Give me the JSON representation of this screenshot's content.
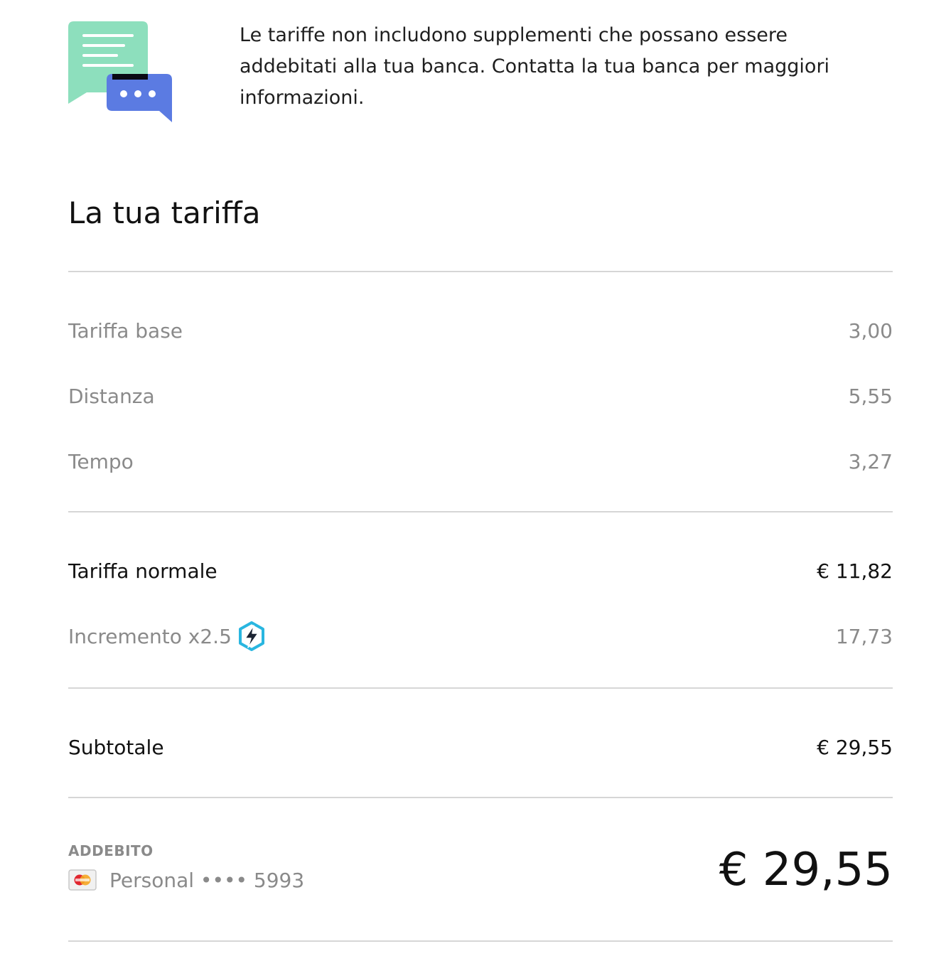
{
  "notice": {
    "icon": "chat-bubbles-icon",
    "text": "Le tariffe non includono supplementi che possano essere addebitati alla tua banca. Contatta la tua banca per maggiori informazioni."
  },
  "fare": {
    "title": "La tua tariffa",
    "breakdown": [
      {
        "label": "Tariffa base",
        "value": "3,00"
      },
      {
        "label": "Distanza",
        "value": "5,55"
      },
      {
        "label": "Tempo",
        "value": "3,27"
      }
    ],
    "normal_fare": {
      "label": "Tariffa normale",
      "value": "€ 11,82"
    },
    "surge": {
      "label": "Incremento x2.5",
      "value": "17,73",
      "icon": "surge-lightning-icon"
    },
    "subtotal": {
      "label": "Subtotale",
      "value": "€ 29,55"
    }
  },
  "charge": {
    "caption": "ADDEBITO",
    "card_icon": "mastercard-icon",
    "method": "Personal •••• 5993",
    "total": "€ 29,55"
  },
  "colors": {
    "muted_text": "#8a8a8a",
    "divider": "#d6d6d6",
    "bubble_green": "#8ddfbd",
    "bubble_blue": "#5b7be2",
    "surge_cyan": "#29b6e0"
  }
}
